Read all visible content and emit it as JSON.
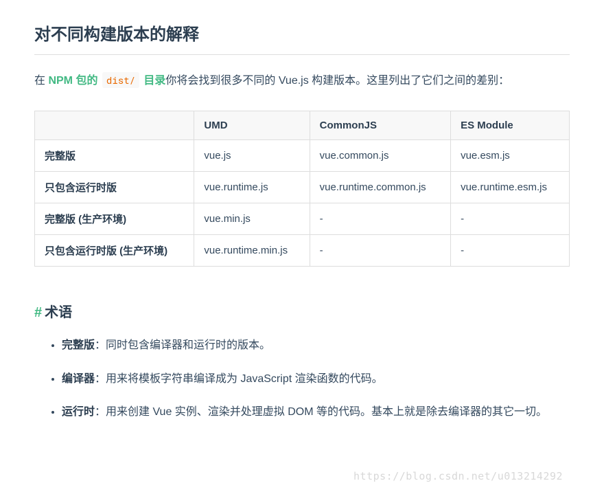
{
  "heading": "对不同构建版本的解释",
  "intro": {
    "pre": "在 ",
    "link1": "NPM 包的",
    "code": "dist/",
    "link2": "目录",
    "post": "你将会找到很多不同的 Vue.js 构建版本。这里列出了它们之间的差别："
  },
  "table": {
    "headers": [
      "",
      "UMD",
      "CommonJS",
      "ES Module"
    ],
    "rows": [
      {
        "label": "完整版",
        "cells": [
          "vue.js",
          "vue.common.js",
          "vue.esm.js"
        ]
      },
      {
        "label": "只包含运行时版",
        "cells": [
          "vue.runtime.js",
          "vue.runtime.common.js",
          "vue.runtime.esm.js"
        ]
      },
      {
        "label": "完整版 (生产环境)",
        "cells": [
          "vue.min.js",
          "-",
          "-"
        ]
      },
      {
        "label": "只包含运行时版 (生产环境)",
        "cells": [
          "vue.runtime.min.js",
          "-",
          "-"
        ]
      }
    ]
  },
  "section": {
    "hash": "#",
    "title": "术语"
  },
  "terms": [
    {
      "name": "完整版",
      "desc": "：同时包含编译器和运行时的版本。"
    },
    {
      "name": "编译器",
      "desc": "：用来将模板字符串编译成为 JavaScript 渲染函数的代码。"
    },
    {
      "name": "运行时",
      "desc": "：用来创建 Vue 实例、渲染并处理虚拟 DOM 等的代码。基本上就是除去编译器的其它一切。"
    }
  ],
  "watermark": "https://blog.csdn.net/u013214292"
}
